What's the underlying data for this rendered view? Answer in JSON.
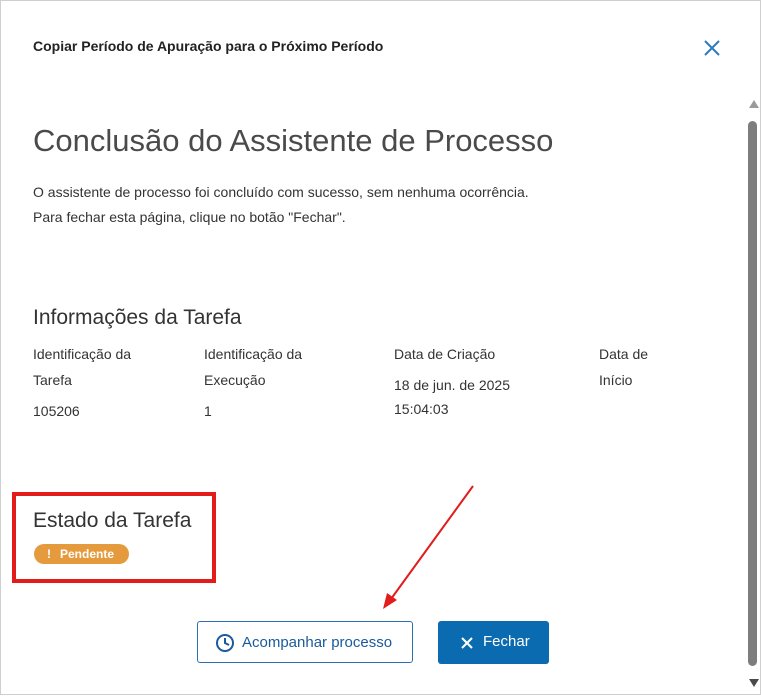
{
  "dialog": {
    "title": "Copiar Período de Apuração para o Próximo Período",
    "close_icon": "close-icon"
  },
  "main": {
    "heading": "Conclusão do Assistente de Processo",
    "desc_line1": "O assistente de processo foi concluído com sucesso, sem nenhuma ocorrência.",
    "desc_line2": "Para fechar esta página, clique no botão \"Fechar\"."
  },
  "task_info": {
    "heading": "Informações da Tarefa",
    "columns": [
      {
        "label": "Identificação da Tarefa",
        "value": "105206"
      },
      {
        "label": "Identificação da Execução",
        "value": "1"
      },
      {
        "label": "Data de Criação",
        "value": "18 de jun. de 2025 15:04:03"
      },
      {
        "label": "Data de Início",
        "value": ""
      }
    ]
  },
  "task_state": {
    "heading": "Estado da Tarefa",
    "badge": "Pendente",
    "badge_icon": "!",
    "badge_color": "#e59b3d"
  },
  "buttons": {
    "track": "Acompanhar processo",
    "track_icon": "clock-icon",
    "close": "Fechar",
    "close_icon": "close-icon"
  },
  "annotation_color": "#e21b1b"
}
